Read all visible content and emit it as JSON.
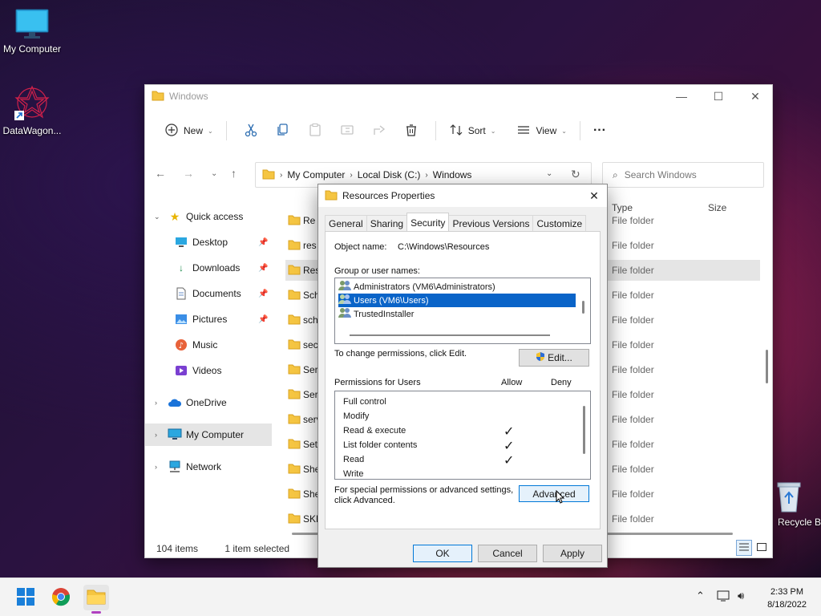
{
  "desktop": {
    "icons": [
      {
        "label": "My Computer",
        "icon": "monitor-icon"
      },
      {
        "label": "DataWagon...",
        "icon": "datawagon-shortcut-icon"
      },
      {
        "label": "Recycle Bin",
        "icon": "recycle-bin-icon"
      }
    ]
  },
  "explorer": {
    "title": "Windows",
    "toolbar": {
      "new_label": "New",
      "sort_label": "Sort",
      "view_label": "View",
      "more_label": "···"
    },
    "address": {
      "crumbs": [
        "My Computer",
        "Local Disk (C:)",
        "Windows"
      ]
    },
    "search_placeholder": "Search Windows",
    "sidebar": {
      "quick_access": "Quick access",
      "items": [
        "Desktop",
        "Downloads",
        "Documents",
        "Pictures",
        "Music",
        "Videos"
      ],
      "onedrive": "OneDrive",
      "my_computer": "My Computer",
      "network": "Network"
    },
    "columns": {
      "type": "Type",
      "size": "Size"
    },
    "files": [
      {
        "name": "Re",
        "type": "File folder"
      },
      {
        "name": "res",
        "type": "File folder"
      },
      {
        "name": "Res",
        "type": "File folder"
      },
      {
        "name": "Sch",
        "type": "File folder"
      },
      {
        "name": "sch",
        "type": "File folder"
      },
      {
        "name": "sec",
        "type": "File folder"
      },
      {
        "name": "Serv",
        "type": "File folder"
      },
      {
        "name": "Serv",
        "type": "File folder"
      },
      {
        "name": "serv",
        "type": "File folder"
      },
      {
        "name": "Setu",
        "type": "File folder"
      },
      {
        "name": "She",
        "type": "File folder"
      },
      {
        "name": "She",
        "type": "File folder"
      },
      {
        "name": "SKB",
        "type": "File folder"
      }
    ],
    "status": {
      "items": "104 items",
      "selected": "1 item selected"
    }
  },
  "dialog": {
    "title": "Resources Properties",
    "tabs": [
      "General",
      "Sharing",
      "Security",
      "Previous Versions",
      "Customize"
    ],
    "object_label": "Object name:",
    "object_value": "C:\\Windows\\Resources",
    "group_label": "Group or user names:",
    "users": [
      "Administrators (VM6\\Administrators)",
      "Users (VM6\\Users)",
      "TrustedInstaller"
    ],
    "change_text": "To change permissions, click Edit.",
    "edit_label": "Edit...",
    "perm_for": "Permissions for Users",
    "allow": "Allow",
    "deny": "Deny",
    "permissions": [
      {
        "name": "Full control",
        "allow": ""
      },
      {
        "name": "Modify",
        "allow": ""
      },
      {
        "name": "Read & execute",
        "allow": "✓"
      },
      {
        "name": "List folder contents",
        "allow": "✓"
      },
      {
        "name": "Read",
        "allow": "✓"
      },
      {
        "name": "Write",
        "allow": ""
      }
    ],
    "special_line1": "For special permissions or advanced settings,",
    "special_line2": "click Advanced.",
    "advanced_label": "Advanced",
    "ok": "OK",
    "cancel": "Cancel",
    "apply": "Apply"
  },
  "taskbar": {
    "time": "2:33 PM",
    "date": "8/18/2022"
  }
}
